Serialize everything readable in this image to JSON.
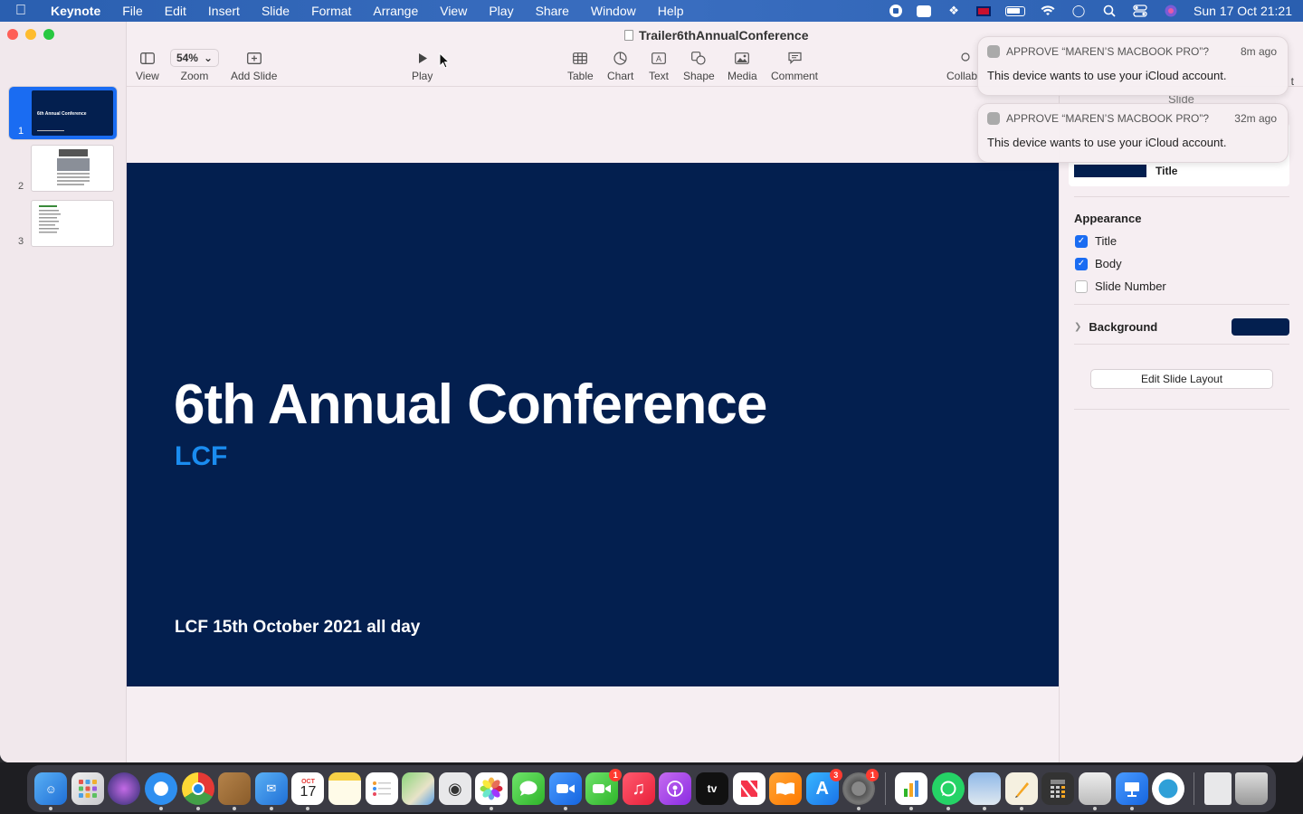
{
  "menubar": {
    "app_name": "Keynote",
    "items": [
      "File",
      "Edit",
      "Insert",
      "Slide",
      "Format",
      "Arrange",
      "View",
      "Play",
      "Share",
      "Window",
      "Help"
    ],
    "clock": "Sun 17 Oct  21:21"
  },
  "window": {
    "title": "Trailer6thAnnualConference"
  },
  "toolbar": {
    "view_label": "View",
    "zoom_value": "54%",
    "zoom_label": "Zoom",
    "add_slide_label": "Add Slide",
    "play_label": "Play",
    "table_label": "Table",
    "chart_label": "Chart",
    "text_label": "Text",
    "shape_label": "Shape",
    "media_label": "Media",
    "comment_label": "Comment",
    "collab_label": "Collab"
  },
  "navigator": {
    "slides": [
      {
        "number": "1",
        "thumb_title": "6th Annual Conference"
      },
      {
        "number": "2"
      },
      {
        "number": "3"
      }
    ]
  },
  "slide": {
    "title": "6th Annual Conference",
    "subtitle": "LCF",
    "body": "LCF 15th October 2021 all day",
    "background_color": "#031f4f",
    "subtitle_color": "#1a8cf0"
  },
  "inspector": {
    "tab_label": "Slide",
    "tab_right_partial": "t",
    "layout_name": "Title",
    "appearance_heading": "Appearance",
    "checks": [
      {
        "label": "Title",
        "checked": true
      },
      {
        "label": "Body",
        "checked": true
      },
      {
        "label": "Slide Number",
        "checked": false
      }
    ],
    "background_label": "Background",
    "edit_layout_button": "Edit Slide Layout"
  },
  "notifications": [
    {
      "title": "APPROVE “MAREN’S MACBOOK PRO”?",
      "time": "8m ago",
      "body": "This device wants to use your iCloud account."
    },
    {
      "title": "APPROVE “MAREN’S MACBOOK PRO”?",
      "time": "32m ago",
      "body": "This device wants to use your iCloud account."
    }
  ],
  "dock": {
    "calendar_month": "OCT",
    "calendar_day": "17",
    "facetime_badge": "1",
    "appstore_badge": "3",
    "settings_badge": "1",
    "tv_label": "tv"
  }
}
